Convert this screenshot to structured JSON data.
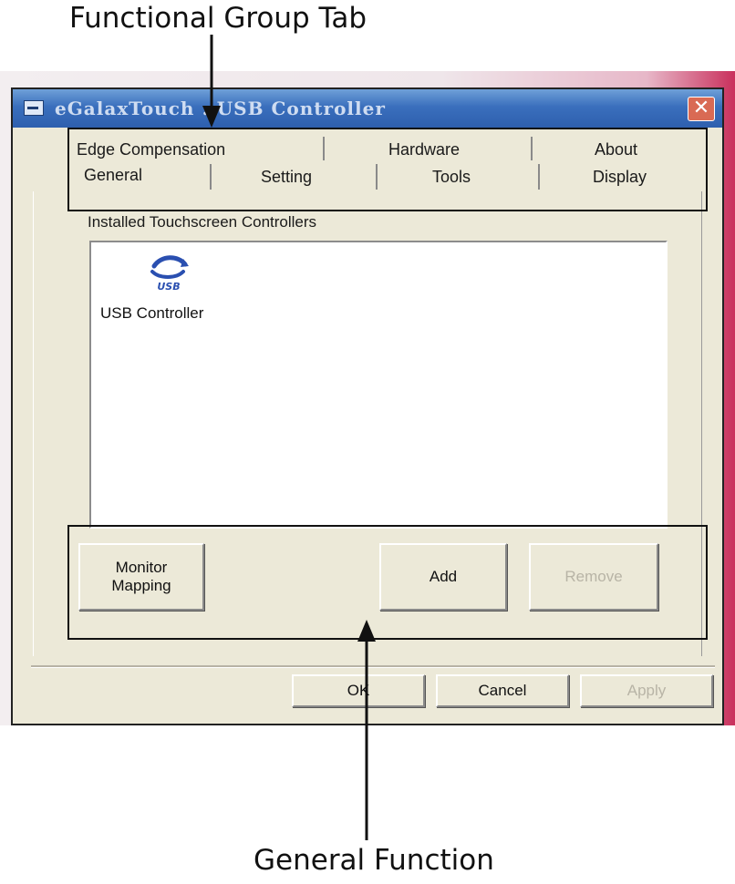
{
  "annotations": {
    "top": "Functional Group Tab",
    "bottom": "General Function"
  },
  "window": {
    "title": "eGalaxTouch : USB Controller",
    "close_symbol": "✕"
  },
  "tabs": {
    "back_row": [
      "Edge Compensation",
      "Hardware",
      "About"
    ],
    "front_row": [
      "General",
      "Setting",
      "Tools",
      "Display"
    ],
    "active": "General"
  },
  "general": {
    "group_label": "Installed Touchscreen Controllers",
    "controllers": [
      {
        "icon": "usb-icon",
        "icon_text": "USB",
        "label": "USB Controller"
      }
    ],
    "buttons": {
      "monitor_mapping": "Monitor\nMapping",
      "add": "Add",
      "remove": "Remove"
    }
  },
  "footer": {
    "ok": "OK",
    "cancel": "Cancel",
    "apply": "Apply"
  },
  "colors": {
    "title_bar": "#3a6fbd",
    "dialog_face": "#ece9d8",
    "close_button": "#d96a54",
    "annotation": "#111111"
  }
}
